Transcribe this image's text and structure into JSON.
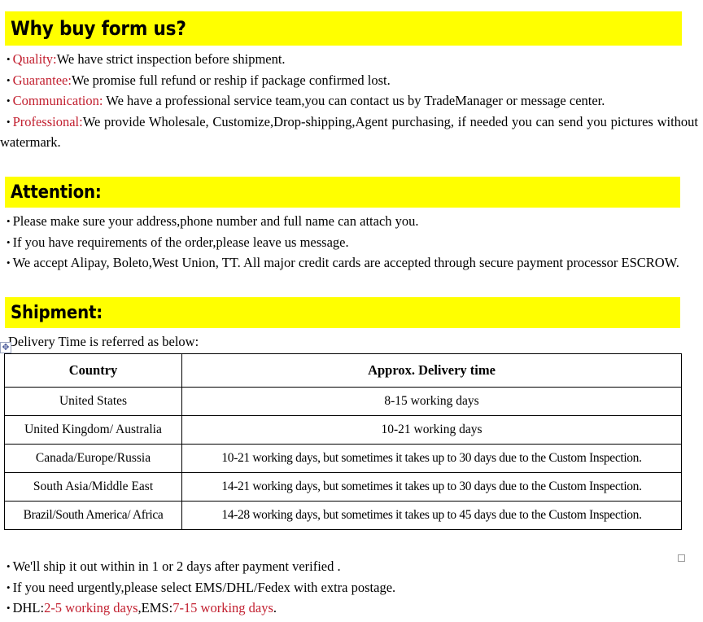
{
  "sections": {
    "why": {
      "heading": "Why buy form us?",
      "bullets": [
        {
          "label": "Quality:",
          "text": "We have strict inspection before shipment."
        },
        {
          "label": "Guarantee:",
          "text": "We promise full refund or reship if package confirmed lost."
        },
        {
          "label": "Communication:",
          "text": " We have a professional service team,you can contact us by TradeManager or message center."
        },
        {
          "label": "Professional:",
          "text": "We provide Wholesale, Customize,Drop-shipping,Agent purchasing, if needed you can send you pictures without watermark."
        }
      ]
    },
    "attention": {
      "heading": "Attention:",
      "bullets": [
        "Please make sure your address,phone number and full name can attach you.",
        "If you have requirements of the order,please leave us message.",
        "We accept Alipay, Boleto,West Union, TT. All major credit cards are accepted through secure payment processor ESCROW."
      ]
    },
    "shipment": {
      "heading": "Shipment:",
      "intro": "Delivery Time is referred as below:",
      "footer_bullets": [
        {
          "pre": "We'll ship it out within in 1 or 2 days after payment verified .",
          "red1": "",
          "mid": "",
          "red2": "",
          "post": ""
        },
        {
          "pre": "If you need urgently,please select EMS/DHL/Fedex with extra postage.",
          "red1": "",
          "mid": "",
          "red2": "",
          "post": ""
        },
        {
          "pre": "DHL:",
          "red1": "2-5 working days",
          "mid": ",EMS:",
          "red2": "7-15 working days",
          "post": "."
        }
      ]
    }
  },
  "table": {
    "headers": [
      "Country",
      "Approx. Delivery time"
    ],
    "rows": [
      [
        "United States",
        "8-15 working days"
      ],
      [
        "United Kingdom/ Australia",
        "10-21 working days"
      ],
      [
        "Canada/Europe/Russia",
        "10-21 working days, but sometimes it takes up to 30 days due to the Custom Inspection."
      ],
      [
        "South Asia/Middle East",
        "14-21 working days, but sometimes it takes up to 30 days due to the Custom Inspection."
      ],
      [
        "Brazil/South America/ Africa",
        "14-28 working days, but sometimes it takes up to 45 days due to the Custom Inspection."
      ]
    ]
  },
  "icons": {
    "table_move_handle": "move-cross-icon",
    "table_resize_handle": "resize-square-icon"
  },
  "colors": {
    "highlight": "#ffff00",
    "accent_red": "#c22030",
    "text": "#000000",
    "background": "#ffffff"
  }
}
